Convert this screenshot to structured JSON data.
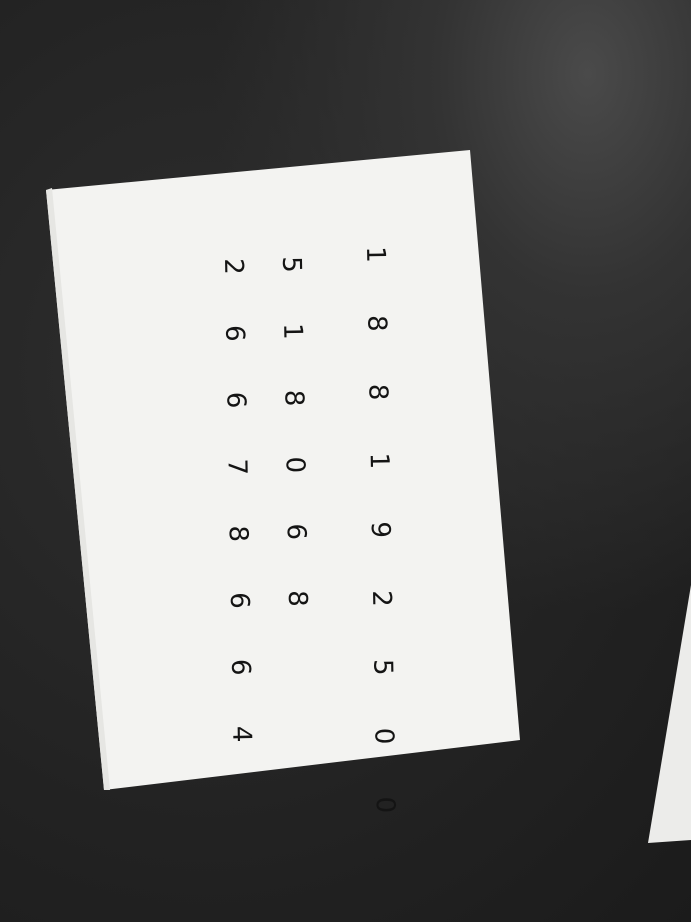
{
  "rows": [
    "1 8 8 1 9 2 5 0 0",
    "5 1 8 0 6 8",
    "2 6 6 7 8 6 6 4"
  ],
  "colors": {
    "background": "#1c1c1c",
    "paper": "#f3f3f1",
    "ink": "#141414"
  }
}
